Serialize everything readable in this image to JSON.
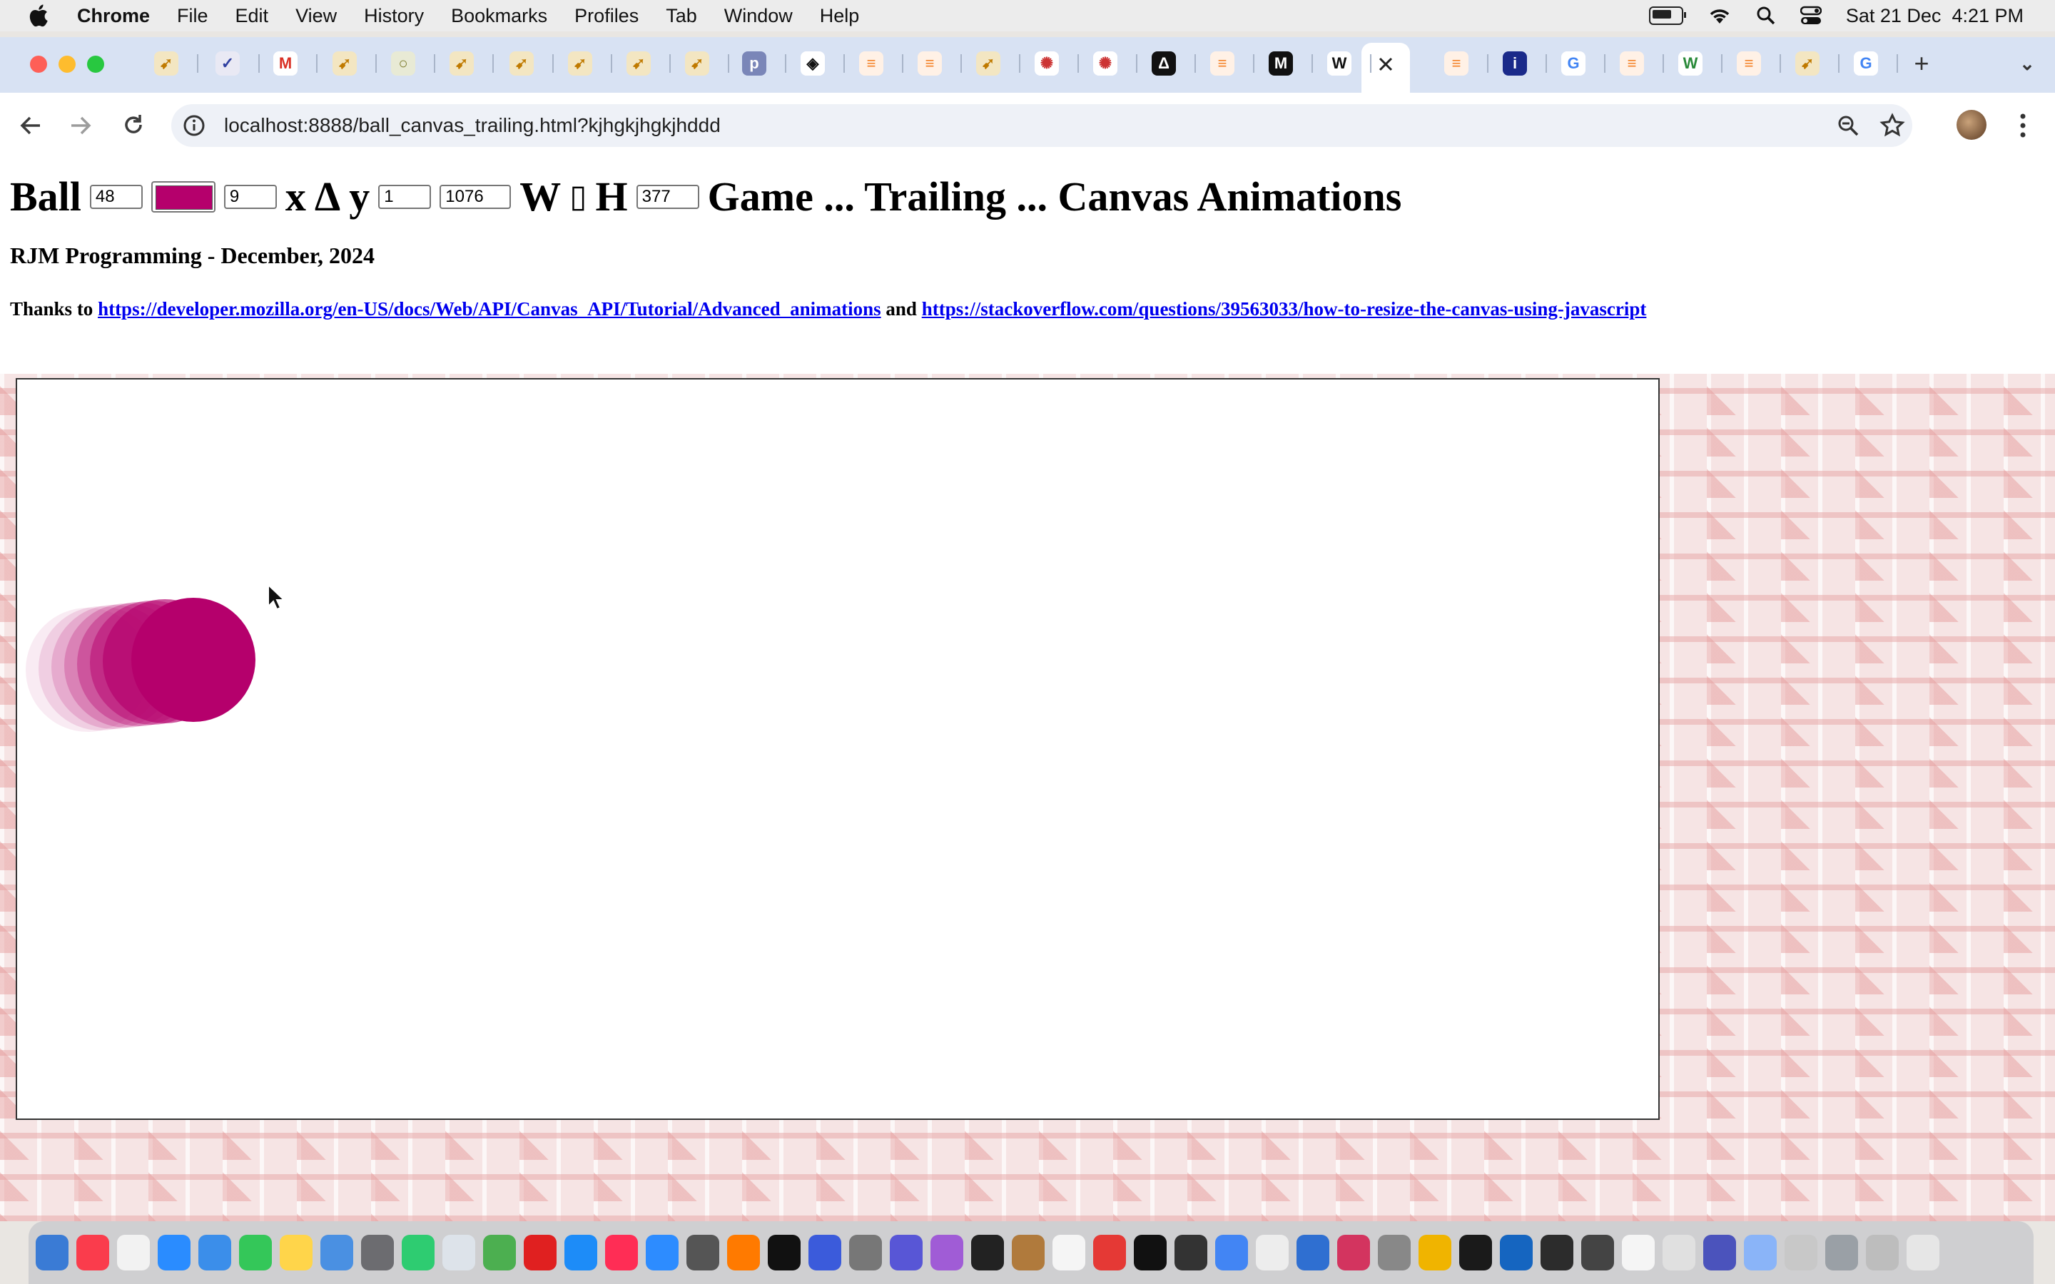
{
  "menubar": {
    "app": "Chrome",
    "items": [
      "File",
      "Edit",
      "View",
      "History",
      "Bookmarks",
      "Profiles",
      "Tab",
      "Window",
      "Help"
    ],
    "clock": "Sat 21 Dec  4:21 PM"
  },
  "browser": {
    "url": "localhost:8888/ball_canvas_trailing.html?kjhgkjhgkjhddd",
    "tab_icons": [
      "rocket",
      "check",
      "gmail",
      "rocket",
      "sol",
      "rocket",
      "rocket",
      "rocket",
      "rocket",
      "rocket",
      "php",
      "codepen",
      "stack",
      "stack",
      "rocket",
      "dots",
      "dots",
      "delta",
      "stack",
      "mdn",
      "wiki",
      "close",
      "stack",
      "info",
      "google",
      "stack",
      "wordpress",
      "stack",
      "rocket",
      "google",
      "plus"
    ]
  },
  "page": {
    "title_ball": "Ball",
    "radius_value": "48",
    "ball_color": "#b5006c",
    "dx_value": "9",
    "title_x": "x",
    "title_delta": "Δ",
    "title_y": "y",
    "dy_value": "1",
    "width_value": "1076",
    "title_w": "W",
    "title_box": "▯",
    "title_h": "H",
    "height_value": "377",
    "title_rest": "Game ... Trailing ... Canvas Animations",
    "subtitle": "RJM Programming - December, 2024",
    "thanks_prefix": "Thanks to",
    "link1": "https://developer.mozilla.org/en-US/docs/Web/API/Canvas_API/Tutorial/Advanced_animations",
    "and_text": "and",
    "link2": "https://stackoverflow.com/questions/39563033/how-to-resize-the-canvas-using-javascript"
  },
  "colors": {
    "ball": "#b5006c",
    "tabstrip": "#d8e2f3"
  }
}
